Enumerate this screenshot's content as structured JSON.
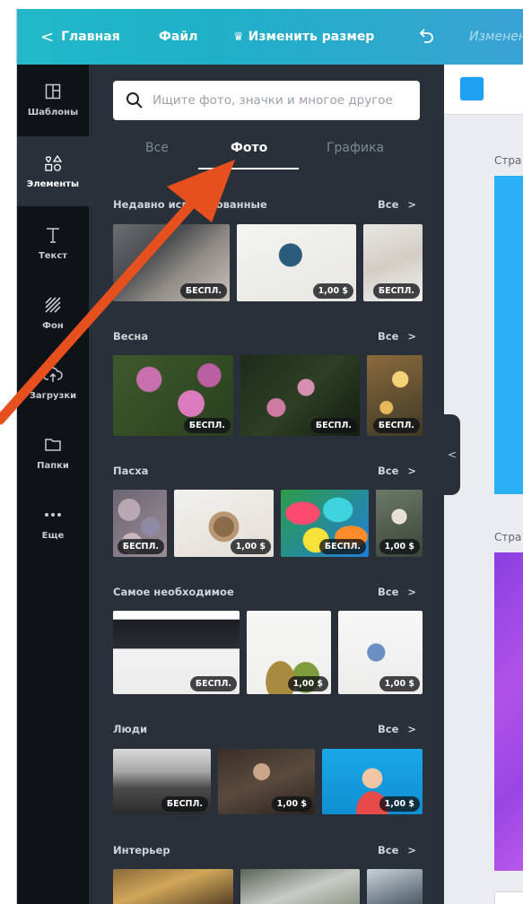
{
  "topbar": {
    "back_label": "Главная",
    "file_label": "Файл",
    "resize_label": "Изменить размер",
    "status_label": "Изменен"
  },
  "rail": {
    "items": [
      {
        "label": "Шаблоны",
        "icon": "templates-icon"
      },
      {
        "label": "Элементы",
        "icon": "elements-icon",
        "active": true
      },
      {
        "label": "Текст",
        "icon": "text-icon"
      },
      {
        "label": "Фон",
        "icon": "background-icon"
      },
      {
        "label": "Загрузки",
        "icon": "uploads-icon"
      },
      {
        "label": "Папки",
        "icon": "folder-icon"
      },
      {
        "label": "Еще",
        "icon": "more-icon"
      }
    ]
  },
  "search": {
    "placeholder": "Ищите фото, значки и многое другое"
  },
  "tabs": [
    {
      "label": "Все"
    },
    {
      "label": "Фото",
      "active": true
    },
    {
      "label": "Графика"
    }
  ],
  "see_all_label": "Все",
  "sections": [
    {
      "title": "Недавно использованные",
      "items": [
        {
          "badge": "БЕСПЛ."
        },
        {
          "badge": "1,00 $"
        },
        {
          "badge": "БЕСПЛ."
        }
      ]
    },
    {
      "title": "Весна",
      "items": [
        {
          "badge": "БЕСПЛ."
        },
        {
          "badge": "БЕСПЛ."
        },
        {
          "badge": "БЕСПЛ."
        }
      ]
    },
    {
      "title": "Пасха",
      "items": [
        {
          "badge": "БЕСПЛ."
        },
        {
          "badge": "1,00 $"
        },
        {
          "badge": "БЕСПЛ."
        },
        {
          "badge": "1,00 $"
        }
      ]
    },
    {
      "title": "Самое необходимое",
      "items": [
        {
          "badge": "БЕСПЛ."
        },
        {
          "badge": "1,00 $"
        },
        {
          "badge": "1,00 $"
        }
      ]
    },
    {
      "title": "Люди",
      "items": [
        {
          "badge": "БЕСПЛ."
        },
        {
          "badge": "1,00 $"
        },
        {
          "badge": "1,00 $"
        }
      ]
    },
    {
      "title": "Интерьер",
      "items": []
    }
  ],
  "canvas": {
    "page_label": "Стра",
    "swatch_color": "#1da1f2"
  },
  "colors": {
    "topbar": "#22b8c9",
    "rail": "#0e1318",
    "panel": "#293039",
    "annotation_arrow": "#e6501f"
  }
}
